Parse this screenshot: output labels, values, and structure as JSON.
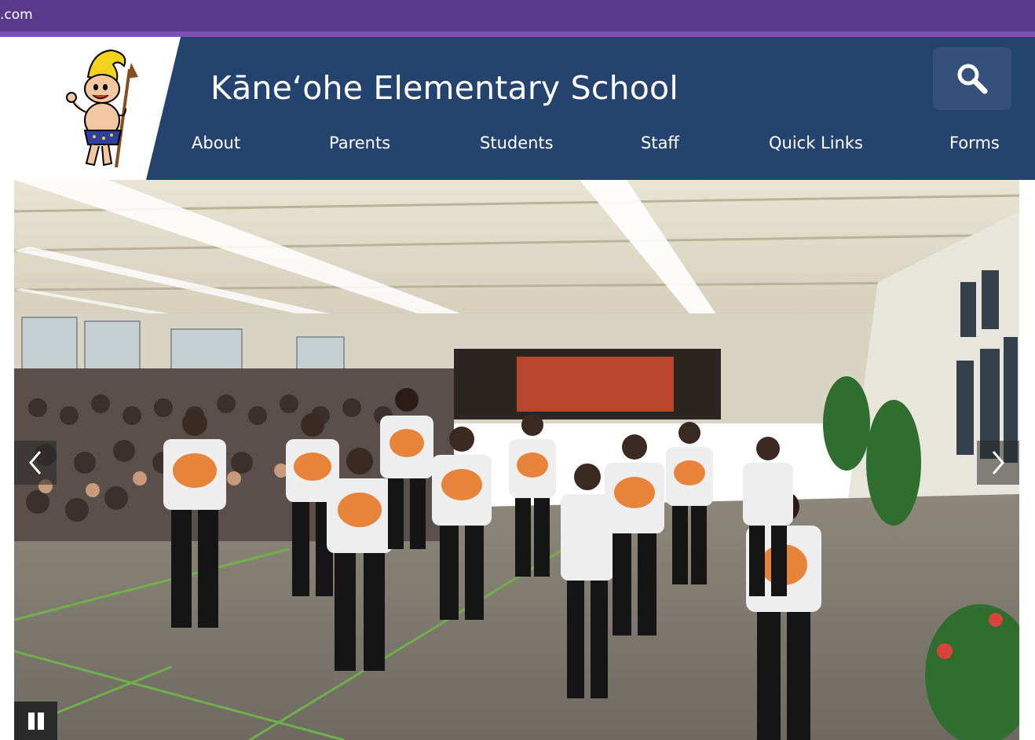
{
  "topbar": {
    "text": ".com"
  },
  "header": {
    "school_name": "Kāneʻohe Elementary School",
    "logo_icon": "school-mascot-warrior-logo",
    "search_icon": "search-icon"
  },
  "nav": {
    "items": [
      {
        "label": "About"
      },
      {
        "label": "Parents"
      },
      {
        "label": "Students"
      },
      {
        "label": "Staff"
      },
      {
        "label": "Quick Links"
      },
      {
        "label": "Forms"
      }
    ]
  },
  "slideshow": {
    "image_description_icon": "hula-performance-photo",
    "prev_icon": "chevron-left-icon",
    "next_icon": "chevron-right-icon",
    "pause_icon": "pause-icon"
  },
  "colors": {
    "topbar": "#5b3a8c",
    "navy": "#24436f",
    "search_bg": "#34507b"
  }
}
